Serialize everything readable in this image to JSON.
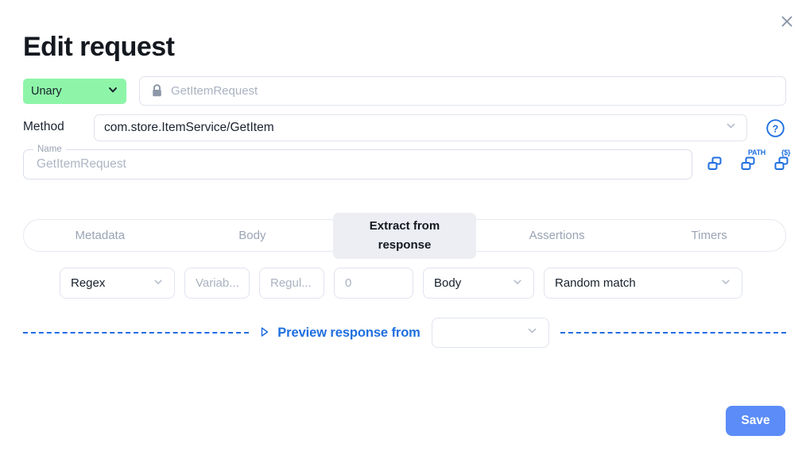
{
  "dialog": {
    "title": "Edit request",
    "close_icon": "close-icon"
  },
  "request": {
    "type_select": {
      "value": "Unary",
      "chevron_icon": "chevron-down-icon",
      "accent_color": "#8ef5a8"
    },
    "target_field": {
      "lock_icon": "lock-icon",
      "value": "GetItemRequest"
    },
    "method": {
      "label": "Method",
      "value": "com.store.ItemService/GetItem",
      "chevron_icon": "chevron-down-icon"
    },
    "help_icon": "help-circle-icon",
    "name_field": {
      "legend": "Name",
      "value": "GetItemRequest"
    },
    "action_icons": [
      {
        "name": "copy-icon",
        "superscript": ""
      },
      {
        "name": "copy-path-icon",
        "superscript": "PATH"
      },
      {
        "name": "copy-variable-icon",
        "superscript": "{$}"
      }
    ]
  },
  "tabs": [
    {
      "label": "Metadata",
      "active": false
    },
    {
      "label": "Body",
      "active": false
    },
    {
      "label": "Extract from response",
      "active": true
    },
    {
      "label": "Assertions",
      "active": false
    },
    {
      "label": "Timers",
      "active": false
    }
  ],
  "extract": {
    "type": {
      "value": "Regex",
      "chevron_icon": "chevron-down-icon"
    },
    "variable": {
      "placeholder": "Variab..."
    },
    "expression": {
      "placeholder": "Regul..."
    },
    "match_number": {
      "placeholder": "0"
    },
    "scope": {
      "value": "Body",
      "chevron_icon": "chevron-down-icon"
    },
    "strategy": {
      "value": "Random match",
      "chevron_icon": "chevron-down-icon"
    }
  },
  "preview": {
    "expand_icon": "play-triangle-icon",
    "label": "Preview response from",
    "source": {
      "value": "",
      "chevron_icon": "chevron-down-icon"
    },
    "divider_color": "#1f6fe0"
  },
  "footer": {
    "save_label": "Save",
    "save_color": "#5b8cf8"
  }
}
